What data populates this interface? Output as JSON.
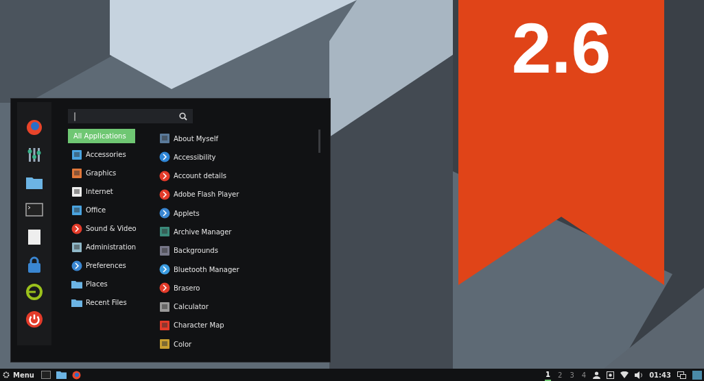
{
  "badge": {
    "text": "2.6"
  },
  "menu": {
    "search": {
      "value": "|"
    },
    "categories": [
      {
        "label": "All Applications",
        "selected": true
      },
      {
        "label": "Accessories",
        "selected": false
      },
      {
        "label": "Graphics",
        "selected": false
      },
      {
        "label": "Internet",
        "selected": false
      },
      {
        "label": "Office",
        "selected": false
      },
      {
        "label": "Sound & Video",
        "selected": false
      },
      {
        "label": "Administration",
        "selected": false
      },
      {
        "label": "Preferences",
        "selected": false
      },
      {
        "label": "Places",
        "selected": false
      },
      {
        "label": "Recent Files",
        "selected": false
      }
    ],
    "applications": [
      {
        "label": "About Myself"
      },
      {
        "label": "Accessibility"
      },
      {
        "label": "Account details"
      },
      {
        "label": "Adobe Flash Player"
      },
      {
        "label": "Applets"
      },
      {
        "label": "Archive Manager"
      },
      {
        "label": "Backgrounds"
      },
      {
        "label": "Bluetooth Manager"
      },
      {
        "label": "Brasero"
      },
      {
        "label": "Calculator"
      },
      {
        "label": "Character Map"
      },
      {
        "label": "Color"
      }
    ]
  },
  "taskbar": {
    "menu_label": "Menu",
    "workspaces": [
      {
        "label": "1",
        "selected": true
      },
      {
        "label": "2",
        "selected": false
      },
      {
        "label": "3",
        "selected": false
      },
      {
        "label": "4",
        "selected": false
      }
    ],
    "clock": "01:43"
  }
}
